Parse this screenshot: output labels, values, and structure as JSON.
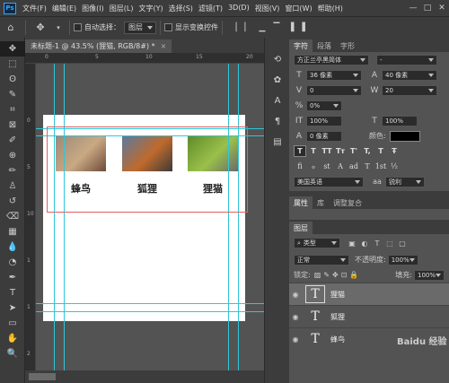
{
  "app": {
    "logo": "Ps"
  },
  "menu": [
    "文件(F)",
    "编辑(E)",
    "图像(I)",
    "图层(L)",
    "文字(Y)",
    "选择(S)",
    "滤镜(T)",
    "3D(D)",
    "视图(V)",
    "窗口(W)",
    "帮助(H)"
  ],
  "window_controls": {
    "minimize": "—",
    "restore": "□",
    "close": "✕"
  },
  "options": {
    "auto_select_label": "自动选择：",
    "auto_select_target": "图层",
    "show_transform_label": "显示变换控件"
  },
  "doc_tab": {
    "title": "未标题-1 @ 43.5% (狸猫, RGB/8#) *",
    "close": "×"
  },
  "ruler_top": [
    "0",
    "5",
    "10",
    "15",
    "20"
  ],
  "ruler_left": [
    "0",
    "5",
    "10",
    "1",
    "1",
    "2"
  ],
  "artboard": {
    "items": [
      {
        "label": "蜂鸟",
        "colors": [
          "#9a8a7a",
          "#c9a983",
          "#6e4a3a"
        ]
      },
      {
        "label": "狐狸",
        "colors": [
          "#5b7aa0",
          "#c06a2c",
          "#3c3a3a"
        ]
      },
      {
        "label": "狸猫",
        "colors": [
          "#5f8a2a",
          "#9ac04a",
          "#6a6a6a"
        ]
      }
    ]
  },
  "char_panel": {
    "tabs": [
      "字符",
      "段落",
      "字形"
    ],
    "font_family": "方正兰亭黑简体",
    "font_style": "-",
    "size": "36 像素",
    "leading": "40 像素",
    "kerning": "0",
    "tracking": "20",
    "scale_pct": "0%",
    "vscale": "100%",
    "hscale": "100%",
    "baseline": "0 像素",
    "color_label": "颜色:",
    "text_color": "#000000",
    "styles": [
      "T",
      "T",
      "TT",
      "Tт",
      "T'",
      "T,",
      "T",
      "Ŧ"
    ],
    "opentype": [
      "fi",
      "ℴ",
      "st",
      "A",
      "ad",
      "T",
      "1st",
      "½"
    ],
    "language": "美国英语",
    "aa_icon": "aa",
    "aa": "锐利"
  },
  "prop_tabs": [
    "属性",
    "库",
    "调整复合"
  ],
  "layers_panel": {
    "title": "图层",
    "filter": "类型",
    "blend": "正常",
    "opacity_label": "不透明度:",
    "opacity": "100%",
    "lock_label": "锁定:",
    "fill_label": "填充:",
    "fill": "100%",
    "layers": [
      {
        "name": "狸猫",
        "selected": true
      },
      {
        "name": "狐狸",
        "selected": false
      },
      {
        "name": "蜂鸟",
        "selected": false
      }
    ]
  },
  "watermark": "Baidu 经验"
}
